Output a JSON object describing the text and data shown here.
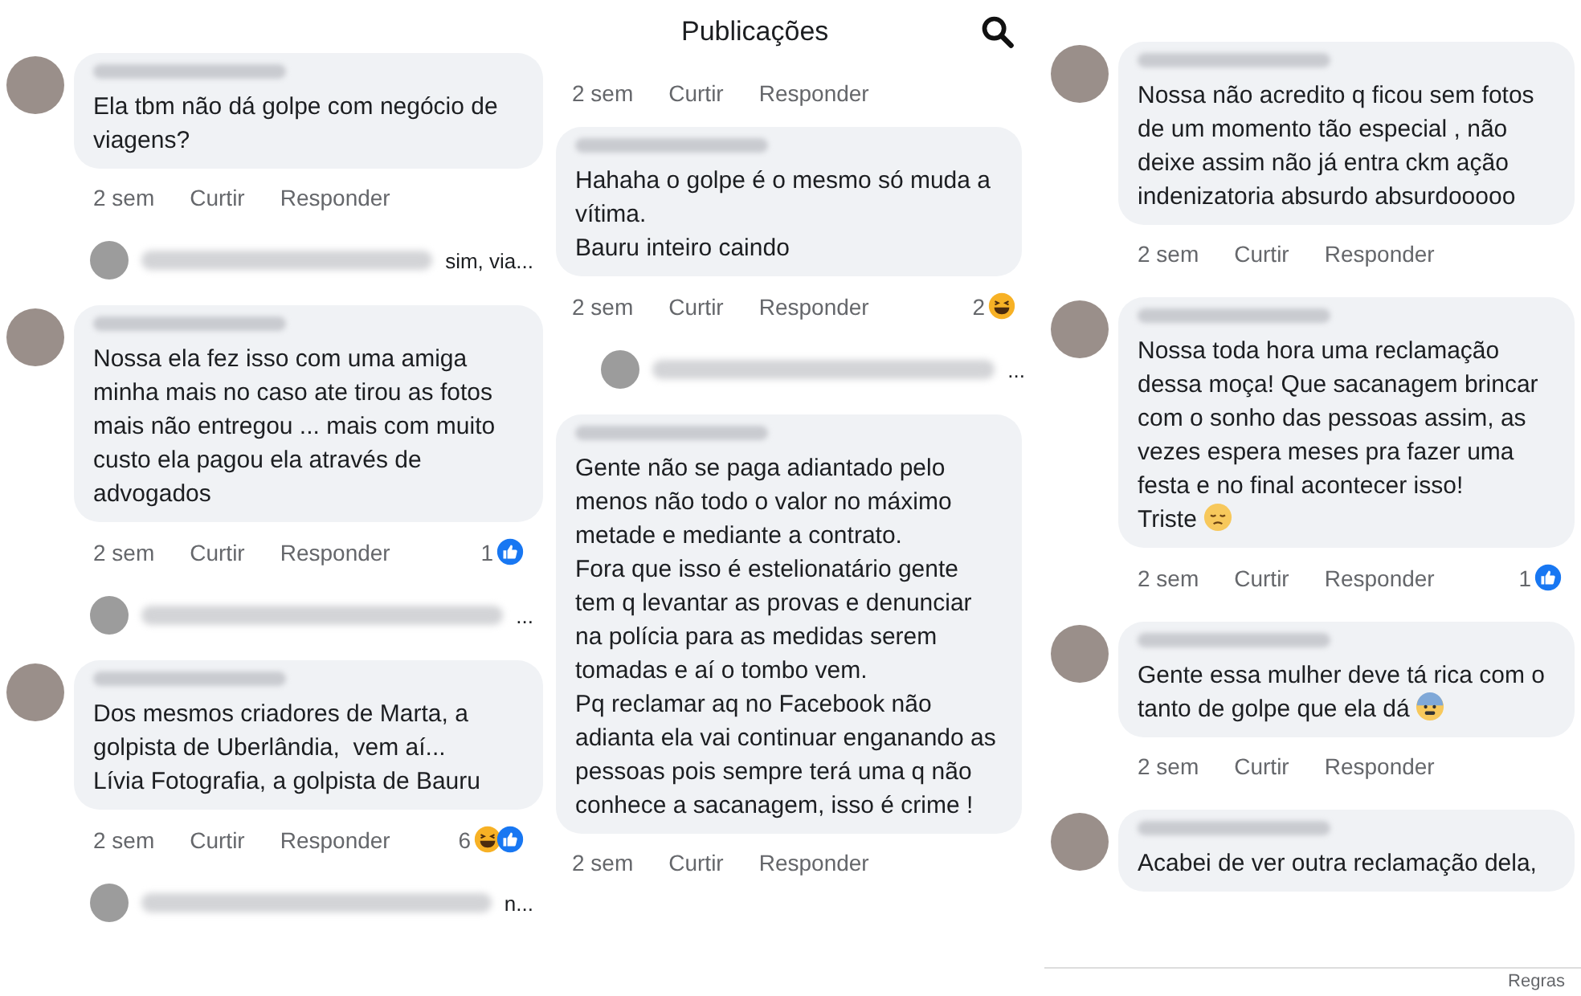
{
  "panels": [
    {
      "items": [
        {
          "kind": "comment",
          "avatar": true,
          "text": "Ela tbm não dá golpe com negócio de viagens?",
          "time": "2 sem",
          "like": "Curtir",
          "reply": "Responder"
        },
        {
          "kind": "reply_preview",
          "text": "sim, via..."
        },
        {
          "kind": "comment",
          "avatar": true,
          "text": "Nossa ela fez isso com uma amiga minha mais no caso ate tirou as fotos mais não entregou ... mais com muito custo ela pagou ela através de advogados",
          "time": "2 sem",
          "like": "Curtir",
          "reply": "Responder",
          "reactions": {
            "count": "1",
            "icons": [
              {
                "kind": "like"
              }
            ]
          }
        },
        {
          "kind": "reply_preview",
          "text": "..."
        },
        {
          "kind": "comment",
          "avatar": true,
          "text": "Dos mesmos criadores de Marta, a golpista de Uberlândia,  vem aí...\nLívia Fotografia, a golpista de Bauru",
          "time": "2 sem",
          "like": "Curtir",
          "reply": "Responder",
          "reactions": {
            "count": "6",
            "icons": [
              {
                "kind": "haha"
              },
              {
                "kind": "like"
              }
            ]
          }
        },
        {
          "kind": "reply_preview",
          "text": "n..."
        }
      ]
    },
    {
      "header": {
        "title": "Publicações"
      },
      "items": [
        {
          "kind": "actions",
          "time": "2 sem",
          "like": "Curtir",
          "reply": "Responder"
        },
        {
          "kind": "comment",
          "avatar": false,
          "text": "Hahaha o golpe é o mesmo só muda a vítima.\nBauru inteiro caindo",
          "time": "2 sem",
          "like": "Curtir",
          "reply": "Responder",
          "reactions": {
            "count": "2",
            "icons": [
              {
                "kind": "haha"
              }
            ]
          }
        },
        {
          "kind": "reply_preview",
          "text": "..."
        },
        {
          "kind": "comment",
          "avatar": false,
          "text": "Gente não se paga adiantado pelo menos não todo o valor no máximo metade e mediante a contrato.\nFora que isso é estelionatário gente tem q levantar as provas e denunciar na polícia para as medidas serem tomadas e aí o tombo vem.\nPq reclamar aq no Facebook não adianta ela vai continuar enganando as pessoas pois sempre terá uma q não conhece a sacanagem, isso é crime !",
          "time": "2 sem",
          "like": "Curtir",
          "reply": "Responder"
        }
      ]
    },
    {
      "items": [
        {
          "kind": "comment",
          "avatar": true,
          "text": "Nossa não acredito q ficou sem fotos de um momento tão especial , não deixe assim não já entra ckm ação indenizatoria absurdo absurdooooo",
          "time": "2 sem",
          "like": "Curtir",
          "reply": "Responder"
        },
        {
          "kind": "comment",
          "avatar": true,
          "text": "Nossa toda hora uma reclamação dessa moça! Que sacanagem brincar com o sonho das pessoas assim, as vezes espera meses pra fazer uma festa e no final acontecer isso!\nTriste",
          "emoji": {
            "kind": "sad"
          },
          "time": "2 sem",
          "like": "Curtir",
          "reply": "Responder",
          "reactions": {
            "count": "1",
            "icons": [
              {
                "kind": "like"
              }
            ]
          }
        },
        {
          "kind": "comment",
          "avatar": true,
          "text": "Gente essa mulher deve tá rica com o tanto de golpe que ela dá",
          "emoji": {
            "kind": "fear"
          },
          "time": "2 sem",
          "like": "Curtir",
          "reply": "Responder"
        },
        {
          "kind": "comment",
          "avatar": true,
          "text": "Acabei de ver outra reclamação dela,"
        }
      ],
      "footer": {
        "text": "Regras"
      }
    }
  ]
}
